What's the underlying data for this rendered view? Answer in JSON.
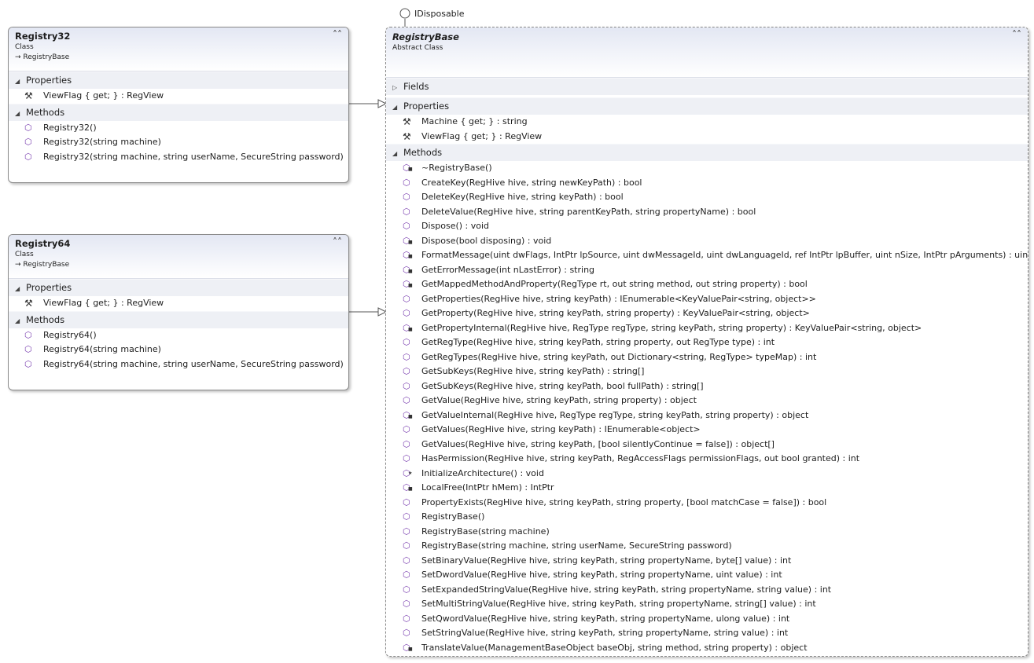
{
  "interface_label": "IDisposable",
  "registry32": {
    "title": "Registry32",
    "kind": "Class",
    "base": "→ RegistryBase",
    "properties_header": "Properties",
    "methods_header": "Methods",
    "properties": [
      "ViewFlag { get; } : RegView"
    ],
    "methods": [
      "Registry32()",
      "Registry32(string machine)",
      "Registry32(string machine, string userName, SecureString password)"
    ]
  },
  "registry64": {
    "title": "Registry64",
    "kind": "Class",
    "base": "→ RegistryBase",
    "properties_header": "Properties",
    "methods_header": "Methods",
    "properties": [
      "ViewFlag { get; } : RegView"
    ],
    "methods": [
      "Registry64()",
      "Registry64(string machine)",
      "Registry64(string machine, string userName, SecureString password)"
    ]
  },
  "registrybase": {
    "title": "RegistryBase",
    "kind": "Abstract Class",
    "fields_header": "Fields",
    "properties_header": "Properties",
    "methods_header": "Methods",
    "properties": [
      "Machine { get; } : string",
      "ViewFlag { get; } : RegView"
    ],
    "methods": [
      {
        "sig": "~RegistryBase()",
        "mod": "private"
      },
      {
        "sig": "CreateKey(RegHive hive, string newKeyPath) : bool",
        "mod": "public"
      },
      {
        "sig": "DeleteKey(RegHive hive, string keyPath) : bool",
        "mod": "public"
      },
      {
        "sig": "DeleteValue(RegHive hive, string parentKeyPath, string propertyName) : bool",
        "mod": "public"
      },
      {
        "sig": "Dispose() : void",
        "mod": "public"
      },
      {
        "sig": "Dispose(bool disposing) : void",
        "mod": "private"
      },
      {
        "sig": "FormatMessage(uint dwFlags, IntPtr lpSource, uint dwMessageId, uint dwLanguageId, ref IntPtr lpBuffer, uint nSize, IntPtr pArguments) : uint",
        "mod": "private"
      },
      {
        "sig": "GetErrorMessage(int nLastError) : string",
        "mod": "private"
      },
      {
        "sig": "GetMappedMethodAndProperty(RegType rt, out string method, out string property) : bool",
        "mod": "private"
      },
      {
        "sig": "GetProperties(RegHive hive, string keyPath) : IEnumerable<KeyValuePair<string, object>>",
        "mod": "public"
      },
      {
        "sig": "GetProperty(RegHive hive, string keyPath, string property) : KeyValuePair<string, object>",
        "mod": "public"
      },
      {
        "sig": "GetPropertyInternal(RegHive hive, RegType regType, string keyPath, string property) : KeyValuePair<string, object>",
        "mod": "private"
      },
      {
        "sig": "GetRegType(RegHive hive, string keyPath, string property, out RegType type) : int",
        "mod": "public"
      },
      {
        "sig": "GetRegTypes(RegHive hive, string keyPath, out Dictionary<string, RegType> typeMap) : int",
        "mod": "public"
      },
      {
        "sig": "GetSubKeys(RegHive hive, string keyPath) : string[]",
        "mod": "public"
      },
      {
        "sig": "GetSubKeys(RegHive hive, string keyPath, bool fullPath) : string[]",
        "mod": "public"
      },
      {
        "sig": "GetValue(RegHive hive, string keyPath, string property) : object",
        "mod": "public"
      },
      {
        "sig": "GetValueInternal(RegHive hive, RegType regType, string keyPath, string property) : object",
        "mod": "private"
      },
      {
        "sig": "GetValues(RegHive hive, string keyPath) : IEnumerable<object>",
        "mod": "public"
      },
      {
        "sig": "GetValues(RegHive hive, string keyPath, [bool silentlyContinue = false]) : object[]",
        "mod": "public"
      },
      {
        "sig": "HasPermission(RegHive hive, string keyPath, RegAccessFlags permissionFlags, out bool granted) : int",
        "mod": "public"
      },
      {
        "sig": "InitializeArchitecture() : void",
        "mod": "protected"
      },
      {
        "sig": "LocalFree(IntPtr hMem) : IntPtr",
        "mod": "private"
      },
      {
        "sig": "PropertyExists(RegHive hive, string keyPath, string property, [bool matchCase = false]) : bool",
        "mod": "public"
      },
      {
        "sig": "RegistryBase()",
        "mod": "public"
      },
      {
        "sig": "RegistryBase(string machine)",
        "mod": "public"
      },
      {
        "sig": "RegistryBase(string machine, string userName, SecureString password)",
        "mod": "public"
      },
      {
        "sig": "SetBinaryValue(RegHive hive, string keyPath, string propertyName, byte[] value) : int",
        "mod": "public"
      },
      {
        "sig": "SetDwordValue(RegHive hive, string keyPath, string propertyName, uint value) : int",
        "mod": "public"
      },
      {
        "sig": "SetExpandedStringValue(RegHive hive, string keyPath, string propertyName, string value) : int",
        "mod": "public"
      },
      {
        "sig": "SetMultiStringValue(RegHive hive, string keyPath, string propertyName, string[] value) : int",
        "mod": "public"
      },
      {
        "sig": "SetQwordValue(RegHive hive, string keyPath, string propertyName, ulong value) : int",
        "mod": "public"
      },
      {
        "sig": "SetStringValue(RegHive hive, string keyPath, string propertyName, string value) : int",
        "mod": "public"
      },
      {
        "sig": "TranslateValue(ManagementBaseObject baseObj, string method, string property) : object",
        "mod": "private"
      }
    ]
  },
  "icons": {
    "collapse": "chevron-double-up-icon",
    "method": "method-cube-icon",
    "property": "wrench-property-icon",
    "lock": "lock-icon",
    "star": "protected-star-icon"
  },
  "colors": {
    "header_gradient_top": "#e3e7f3",
    "section_bg": "#eef0f5",
    "method_icon": "#7a3fb0"
  }
}
